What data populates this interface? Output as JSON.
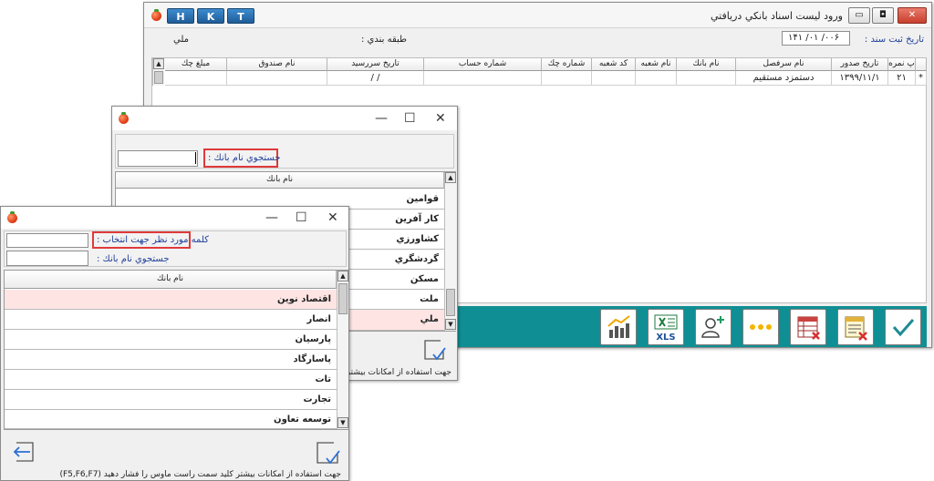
{
  "main": {
    "title": "ورود ليست اسناد بانكي دريافتي",
    "hkt": [
      "H",
      "K",
      "T"
    ],
    "date_label": "تاريخ ثبت سند :",
    "date_value": "١۴٠٠/ ٠١/ ١۶",
    "category_label": "طبقه بندي :",
    "category_value": "ملي",
    "columns": [
      "پ نمره",
      "تاريخ صدور",
      "نام سرفصل",
      "نام بانك",
      "نام شعبه",
      "كد شعبه",
      "شماره چك",
      "شماره حساب",
      "تاريخ سررسيد",
      "نام صندوق",
      "مبلغ چك"
    ],
    "row": {
      "marker": "*",
      "num": "٢١",
      "issue_date": "١٣٩٩/١١/١",
      "account": "دستمزد مستقيم",
      "due_date": "/ /"
    }
  },
  "dialog1": {
    "search_label": "جستجوي  نام بانك :",
    "column": "نام بانك",
    "items": [
      "قوامين",
      "كار آفرين",
      "كشاورزي",
      "گردشگري",
      "مسكن",
      "ملت",
      "ملي"
    ],
    "selected_index": 6,
    "status": "جهت استفاده از امكانات بيشتر"
  },
  "dialog2": {
    "keyword_label": "كلمه مورد نظر جهت انتخاب :",
    "search_label": "جستجوي  نام بانك :",
    "column": "نام بانك",
    "items": [
      "اقتصاد نوين",
      "انصار",
      "پارسيان",
      "پاسارگاد",
      "تات",
      "تجارت",
      "توسعه تعاون"
    ],
    "selected_index": 0,
    "status": "جهت استفاده از امكانات بيشتر كليد سمت راست ماوس را فشار دهيد (F5,F6,F7)"
  },
  "icons": {
    "chart": "chart-report-icon",
    "excel": "xls-export-icon",
    "add_person": "add-person-icon",
    "more": "more-dots-icon",
    "delete_table": "table-delete-icon",
    "delete_doc": "document-delete-icon",
    "confirm": "check-icon"
  },
  "colors": {
    "toolbar": "#0f8f94",
    "highlight_box": "#e03a3a",
    "selected_row": "#ffe4e4"
  }
}
